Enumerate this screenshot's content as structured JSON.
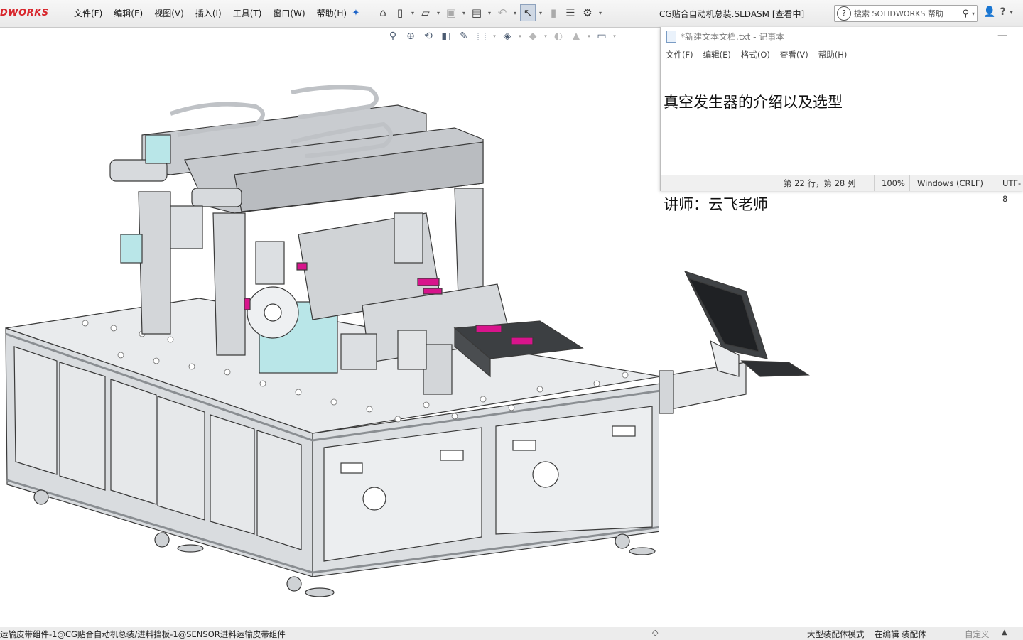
{
  "app": {
    "logo": "DWORKS",
    "menus": [
      "文件(F)",
      "编辑(E)",
      "视图(V)",
      "插入(I)",
      "工具(T)",
      "窗口(W)",
      "帮助(H)"
    ],
    "document_title": "CG贴合自动机总装.SLDASM [查看中]",
    "search_placeholder": "搜索 SOLIDWORKS 帮助",
    "toolbar_icons": [
      "home-icon",
      "new-icon",
      "open-icon",
      "save-icon",
      "print-icon",
      "undo-icon",
      "select-icon",
      "rebuild-icon",
      "file-properties-icon",
      "options-icon"
    ],
    "view_toolbar_icons": [
      "zoom-to-fit-icon",
      "zoom-area-icon",
      "previous-view-icon",
      "section-view-icon",
      "dynamic-annotation-icon",
      "view-orientation-icon",
      "display-style-icon",
      "hide-show-icon",
      "edit-appearance-icon",
      "scene-icon",
      "view-settings-icon"
    ]
  },
  "notepad": {
    "title": "*新建文本文档.txt - 记事本",
    "menus": [
      "文件(F)",
      "编辑(E)",
      "格式(O)",
      "查看(V)",
      "帮助(H)"
    ],
    "content_line1": "真空发生器的介绍以及选型",
    "content_line2": "",
    "content_line3": "讲师：云飞老师",
    "status": {
      "position": "第 22 行，第 28 列",
      "zoom": "100%",
      "line_ending": "Windows (CRLF)",
      "encoding": "UTF-8"
    }
  },
  "statusbar": {
    "path": "运输皮带组件-1@CG贴合自动机总装/进料挡板-1@SENSOR进料运输皮带组件",
    "mode": "大型装配体模式",
    "editing": "在编辑 装配体",
    "custom": "自定义",
    "up_arrow": "▲"
  },
  "colors": {
    "accent_red": "#d8262c",
    "machine_frame": "#d9dcdf",
    "machine_edge": "#3a3a3a",
    "cyan_part": "#b9e6e8",
    "magenta_part": "#d8148c",
    "background": "#ffffff"
  }
}
